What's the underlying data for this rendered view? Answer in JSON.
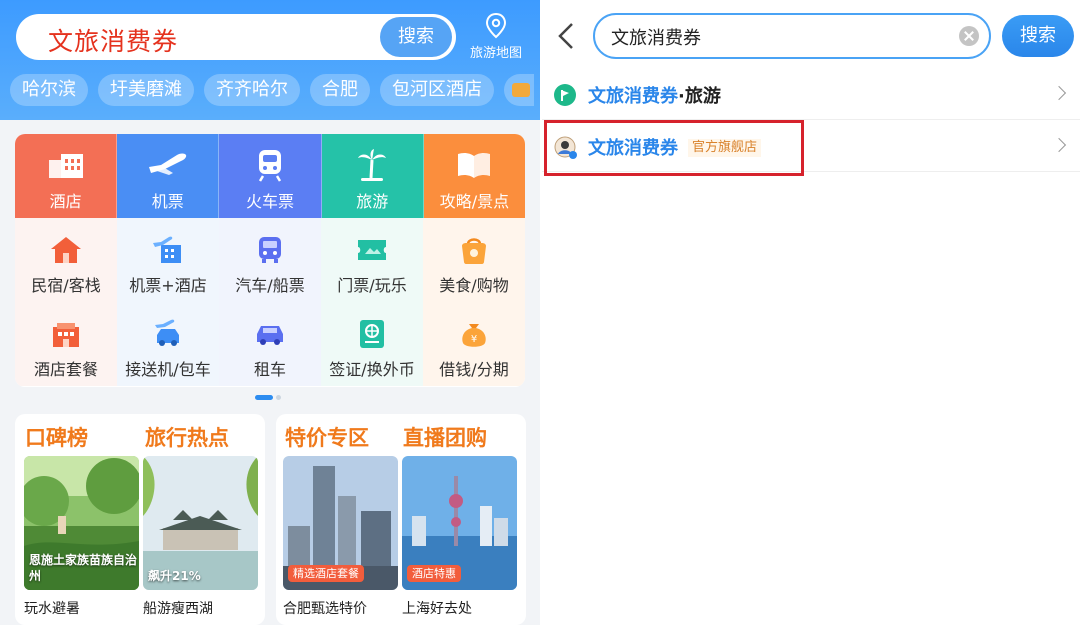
{
  "left": {
    "search": {
      "value": "文旅消费券",
      "button": "搜索"
    },
    "map": {
      "label": "旅游地图",
      "icon": "map-pin-icon"
    },
    "chips": [
      "哈尔滨",
      "圩美磨滩",
      "齐齐哈尔",
      "合肥",
      "包河区酒店"
    ],
    "top_row": [
      {
        "label": "酒店",
        "icon": "hotel-icon",
        "color": "#f36f55"
      },
      {
        "label": "机票",
        "icon": "plane-icon",
        "color": "#4a8ef4"
      },
      {
        "label": "火车票",
        "icon": "train-icon",
        "color": "#5b7ef3"
      },
      {
        "label": "旅游",
        "icon": "palm-tree-icon",
        "color": "#25c2a8"
      },
      {
        "label": "攻略/景点",
        "icon": "book-icon",
        "color": "#fb8e3d"
      }
    ],
    "row2": [
      {
        "label": "民宿/客栈",
        "icon": "house-icon"
      },
      {
        "label": "机票+酒店",
        "icon": "plane-hotel-icon"
      },
      {
        "label": "汽车/船票",
        "icon": "bus-icon"
      },
      {
        "label": "门票/玩乐",
        "icon": "ticket-icon"
      },
      {
        "label": "美食/购物",
        "icon": "shopping-bag-icon"
      }
    ],
    "row3": [
      {
        "label": "酒店套餐",
        "icon": "hotel-package-icon"
      },
      {
        "label": "接送机/包车",
        "icon": "pickup-car-icon"
      },
      {
        "label": "租车",
        "icon": "car-icon"
      },
      {
        "label": "签证/换外币",
        "icon": "visa-icon"
      },
      {
        "label": "借钱/分期",
        "icon": "money-bag-icon"
      }
    ],
    "promo_left": {
      "title1": "口碑榜",
      "title2": "旅行热点",
      "card1": {
        "overlay": "恩施土家族苗族自治州",
        "caption": "玩水避暑"
      },
      "card2": {
        "overlay": "飙升21%",
        "caption": "船游瘦西湖"
      }
    },
    "promo_right": {
      "title1": "特价专区",
      "title2": "直播团购",
      "card1": {
        "badge": "精选酒店套餐",
        "caption": "合肥甄选特价"
      },
      "card2": {
        "badge": "酒店特惠",
        "caption": "上海好去处"
      }
    }
  },
  "right": {
    "search": {
      "value": "文旅消费券",
      "button": "搜索"
    },
    "suggestions": [
      {
        "name": "文旅消费券",
        "suffix": "·旅游",
        "icon": "travel-logo-icon"
      },
      {
        "name": "文旅消费券",
        "tag": "官方旗舰店",
        "icon": "official-store-avatar-icon"
      }
    ]
  },
  "colors": {
    "header_blue": "#3d9bff",
    "accent_orange": "#f07a1c",
    "link_blue": "#2a86ea",
    "highlight_red": "#d6222c"
  }
}
